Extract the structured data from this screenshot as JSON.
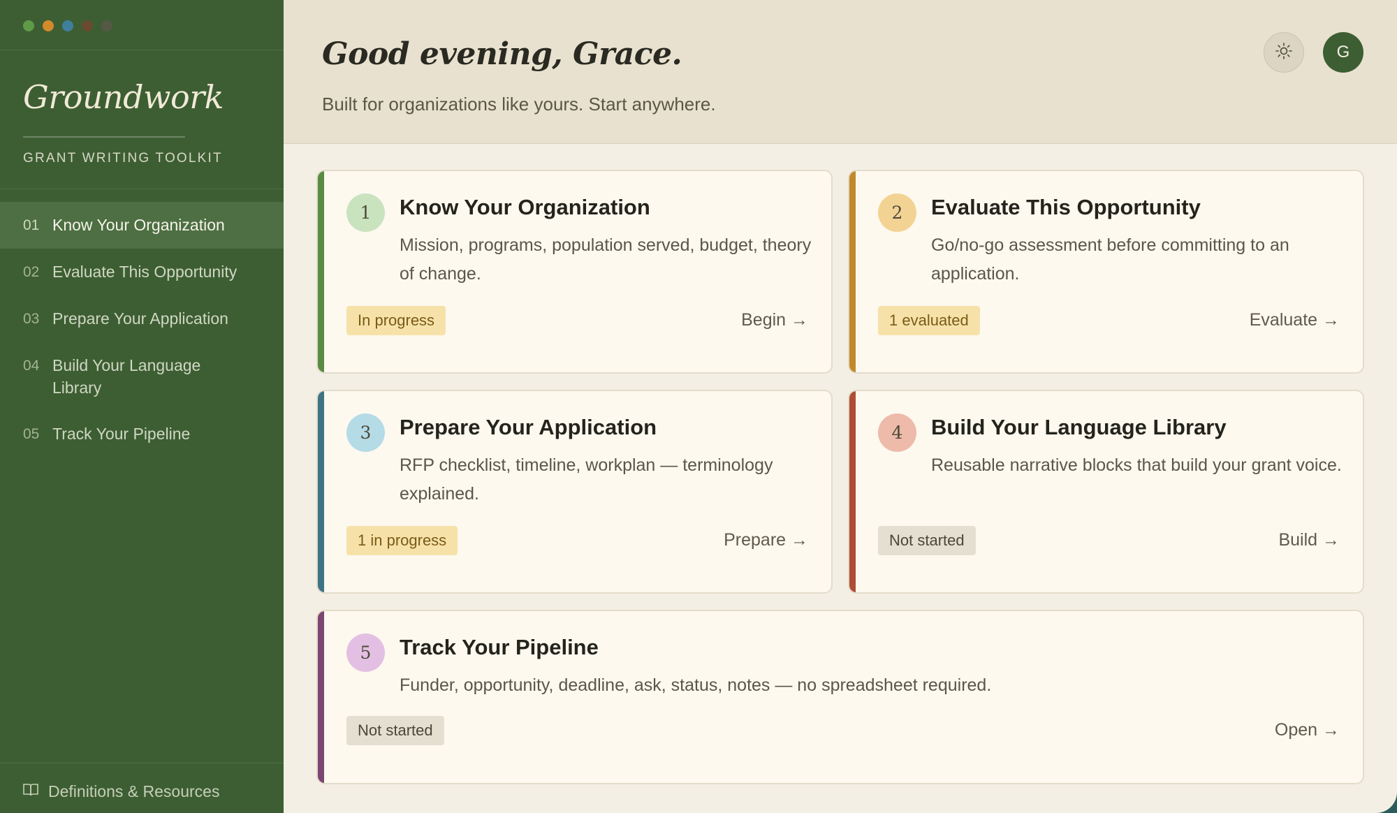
{
  "window_controls": [
    {
      "name": "close",
      "color": "#5f9a48"
    },
    {
      "name": "minimize",
      "color": "#d28a2a"
    },
    {
      "name": "zoom",
      "color": "#3f7f9c"
    },
    {
      "name": "extra-1",
      "color": "#6a4a30"
    },
    {
      "name": "extra-2",
      "color": "#555845"
    }
  ],
  "sidebar": {
    "brand": "Groundwork",
    "subtitle": "GRANT WRITING TOOLKIT",
    "items": [
      {
        "num": "01",
        "label": "Know Your Organization",
        "active": true
      },
      {
        "num": "02",
        "label": "Evaluate This Opportunity"
      },
      {
        "num": "03",
        "label": "Prepare Your Application"
      },
      {
        "num": "04",
        "label": "Build Your Language Library"
      },
      {
        "num": "05",
        "label": "Track Your Pipeline"
      }
    ],
    "footer": {
      "label": "Definitions & Resources",
      "icon": "book-icon"
    }
  },
  "header": {
    "greeting": "Good evening, Grace.",
    "tagline": "Built for organizations like yours. Start anywhere.",
    "theme_icon": "sun-icon",
    "avatar_initial": "G"
  },
  "cards": [
    {
      "num": "1",
      "title": "Know Your Organization",
      "desc": "Mission, programs, population served, budget, theory of change.",
      "badge": "In progress",
      "badge_style": "warn",
      "action": "Begin →",
      "accent": "#5b8a45",
      "circle": "#c9e3bf"
    },
    {
      "num": "2",
      "title": "Evaluate This Opportunity",
      "desc": "Go/no-go assessment before committing to an application.",
      "badge": "1 evaluated",
      "badge_style": "warn",
      "action": "Evaluate →",
      "accent": "#c2892b",
      "circle": "#f3d393"
    },
    {
      "num": "3",
      "title": "Prepare Your Application",
      "desc": "RFP checklist, timeline, workplan — terminology explained.",
      "badge": "1 in progress",
      "badge_style": "warn",
      "action": "Prepare →",
      "accent": "#3f7485",
      "circle": "#b5dbe6"
    },
    {
      "num": "4",
      "title": "Build Your Language Library",
      "desc": "Reusable narrative blocks that build your grant voice.",
      "badge": "Not started",
      "badge_style": "muted",
      "action": "Build →",
      "accent": "#ad4d33",
      "circle": "#eebaa9"
    },
    {
      "num": "5",
      "title": "Track Your Pipeline",
      "desc": "Funder, opportunity, deadline, ask, status, notes — no spreadsheet required.",
      "badge": "Not started",
      "badge_style": "muted",
      "action": "Open →",
      "accent": "#7a4672",
      "circle": "#e3c0e3"
    }
  ]
}
